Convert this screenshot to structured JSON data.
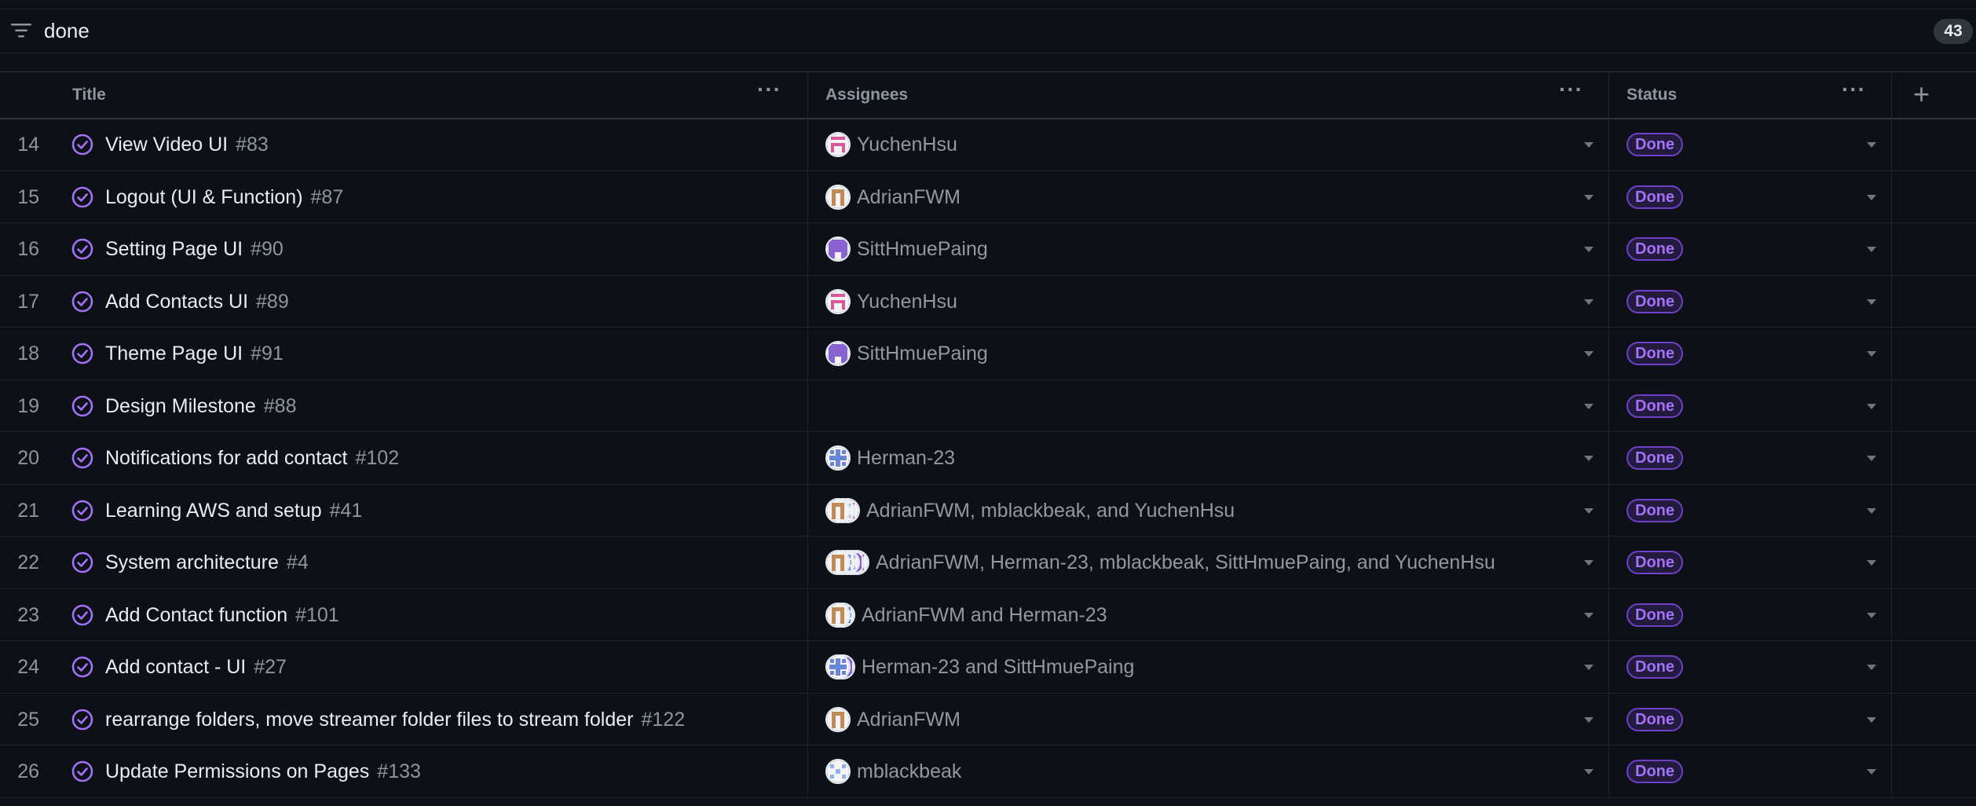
{
  "filter": {
    "query": "done",
    "count": "43"
  },
  "columns": {
    "title": "Title",
    "assignees": "Assignees",
    "status": "Status"
  },
  "colors": {
    "done_purple": "#a371f7",
    "bg": "#0d1117"
  },
  "rows": [
    {
      "num": "14",
      "title": "View Video UI",
      "issue": "#83",
      "avatars": [
        "yuchen"
      ],
      "assignees": "YuchenHsu",
      "status": "Done"
    },
    {
      "num": "15",
      "title": "Logout (UI & Function)",
      "issue": "#87",
      "avatars": [
        "adrian"
      ],
      "assignees": "AdrianFWM",
      "status": "Done"
    },
    {
      "num": "16",
      "title": "Setting Page UI",
      "issue": "#90",
      "avatars": [
        "sitt"
      ],
      "assignees": "SittHmuePaing",
      "status": "Done"
    },
    {
      "num": "17",
      "title": "Add Contacts UI",
      "issue": "#89",
      "avatars": [
        "yuchen"
      ],
      "assignees": "YuchenHsu",
      "status": "Done"
    },
    {
      "num": "18",
      "title": "Theme Page UI",
      "issue": "#91",
      "avatars": [
        "sitt"
      ],
      "assignees": "SittHmuePaing",
      "status": "Done"
    },
    {
      "num": "19",
      "title": "Design Milestone",
      "issue": "#88",
      "avatars": [],
      "assignees": "",
      "status": "Done"
    },
    {
      "num": "20",
      "title": "Notifications for add contact",
      "issue": "#102",
      "avatars": [
        "herman"
      ],
      "assignees": "Herman-23",
      "status": "Done"
    },
    {
      "num": "21",
      "title": "Learning AWS and setup",
      "issue": "#41",
      "avatars": [
        "adrian",
        "mblack",
        "yuchen"
      ],
      "assignees": "AdrianFWM, mblackbeak, and YuchenHsu",
      "status": "Done"
    },
    {
      "num": "22",
      "title": "System architecture",
      "issue": "#4",
      "avatars": [
        "adrian",
        "herman",
        "mblack",
        "sitt",
        "yuchen"
      ],
      "assignees": "AdrianFWM, Herman-23, mblackbeak, SittHmuePaing, and YuchenHsu",
      "status": "Done"
    },
    {
      "num": "23",
      "title": "Add Contact function",
      "issue": "#101",
      "avatars": [
        "adrian",
        "herman"
      ],
      "assignees": "AdrianFWM and Herman-23",
      "status": "Done"
    },
    {
      "num": "24",
      "title": "Add contact - UI",
      "issue": "#27",
      "avatars": [
        "herman",
        "sitt"
      ],
      "assignees": "Herman-23 and SittHmuePaing",
      "status": "Done"
    },
    {
      "num": "25",
      "title": "rearrange folders, move streamer folder files to stream folder",
      "issue": "#122",
      "avatars": [
        "adrian"
      ],
      "assignees": "AdrianFWM",
      "status": "Done"
    },
    {
      "num": "26",
      "title": "Update Permissions on Pages",
      "issue": "#133",
      "avatars": [
        "mblack"
      ],
      "assignees": "mblackbeak",
      "status": "Done"
    }
  ]
}
